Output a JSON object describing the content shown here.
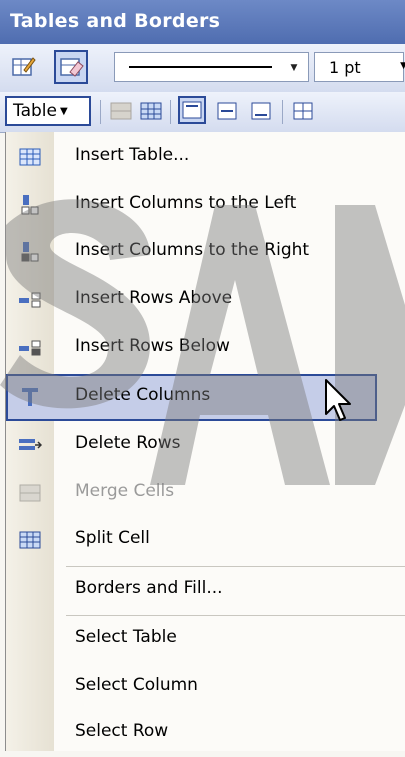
{
  "window": {
    "title": "Tables and Borders"
  },
  "toolbar_top": {
    "line_weight": "1 pt"
  },
  "toolbar_second": {
    "table_button_label": "Table"
  },
  "menu": {
    "items": [
      {
        "label": "Insert Table...",
        "icon": "insert-table-icon"
      },
      {
        "label": "Insert Columns to the Left",
        "icon": "insert-columns-left-icon"
      },
      {
        "label": "Insert Columns to the Right",
        "icon": "insert-columns-right-icon"
      },
      {
        "label": "Insert Rows Above",
        "icon": "insert-rows-above-icon"
      },
      {
        "label": "Insert Rows Below",
        "icon": "insert-rows-below-icon"
      },
      {
        "label": "Delete Columns",
        "icon": "delete-columns-icon",
        "highlighted": true
      },
      {
        "label": "Delete Rows",
        "icon": "delete-rows-icon"
      },
      {
        "label": "Merge Cells",
        "icon": "merge-cells-icon",
        "disabled": true
      },
      {
        "label": "Split Cell",
        "icon": "split-cell-icon"
      },
      {
        "label": "Borders and Fill..."
      },
      {
        "label": "Select Table"
      },
      {
        "label": "Select Column"
      },
      {
        "label": "Select Row"
      }
    ]
  },
  "colors": {
    "title_bar": "#5a78ba",
    "highlight": "#c5cde8",
    "highlight_border": "#2b4a98",
    "watermark": "#8a8a8a"
  }
}
